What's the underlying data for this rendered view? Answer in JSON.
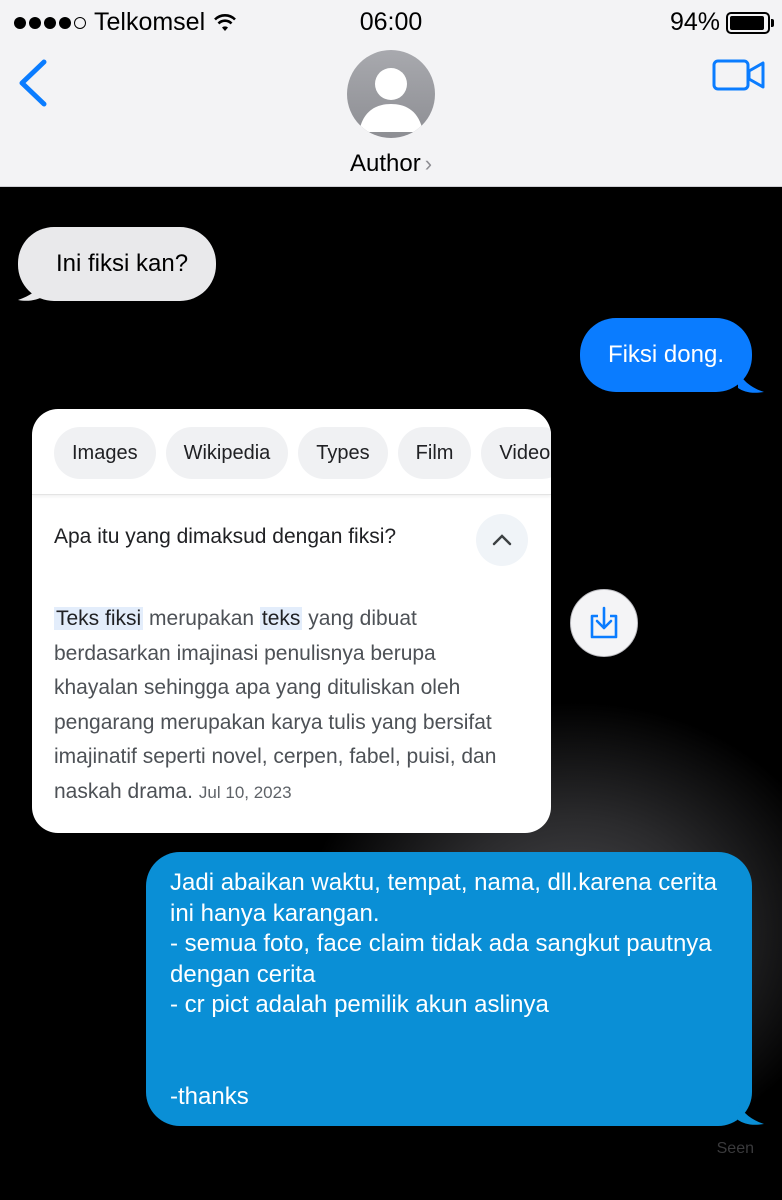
{
  "status_bar": {
    "carrier": "Telkomsel",
    "time": "06:00",
    "battery": "94%",
    "battery_level": 0.94
  },
  "header": {
    "contact_name": "Author",
    "chevron": "›",
    "back_icon": "chevron-left-icon",
    "video_icon": "video-camera-icon",
    "accent": "#0a7cff"
  },
  "messages": {
    "in_1": "Ini fiksi kan?",
    "out_1": "Fiksi dong.",
    "out_2": "Jadi abaikan waktu, tempat, nama, dll.karena cerita ini hanya karangan.\n- semua foto, face claim tidak ada sangkut pautnya dengan cerita\n- cr pict adalah pemilik akun aslinya\n\n\n-thanks",
    "seen": "Seen"
  },
  "search_card": {
    "chips": [
      "Images",
      "Wikipedia",
      "Types",
      "Film",
      "Video"
    ],
    "question": "Apa itu yang dimaksud dengan fiksi?",
    "answer": {
      "hl1": "Teks fiksi",
      "t1": " merupakan ",
      "hl2": "teks",
      "t2": " yang dibuat berdasarkan imajinasi penulisnya berupa khayalan sehingga apa yang dituliskan oleh pengarang merupakan karya tulis yang bersifat imajinatif seperti novel, cerpen, fabel, puisi, dan naskah drama.",
      "date": "Jul 10, 2023"
    }
  },
  "colors": {
    "incoming": "#e9e9eb",
    "outgoing": "#0a7cff",
    "outgoing_alt": "#0a8fd6"
  }
}
